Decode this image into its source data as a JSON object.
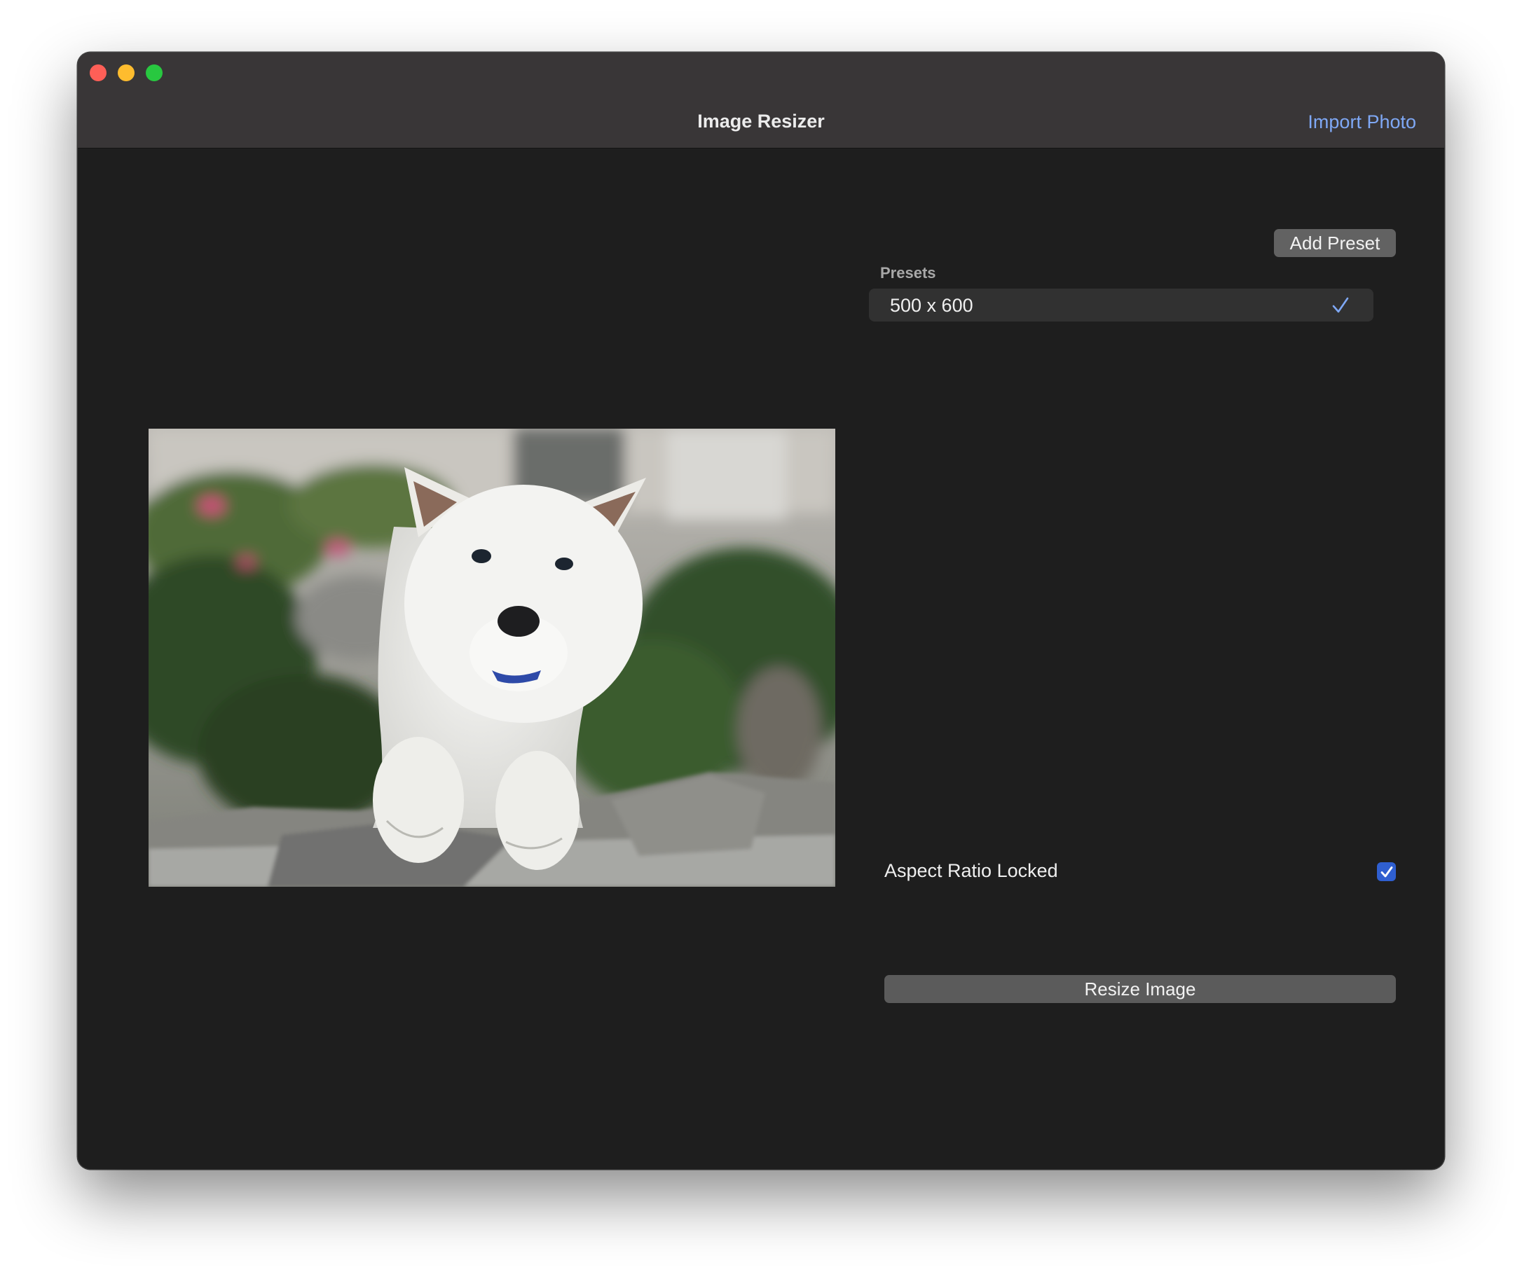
{
  "window": {
    "title": "Image Resizer",
    "import_label": "Import Photo"
  },
  "colors": {
    "accent_link": "#7fa8f5",
    "checkbox": "#2f5fd0",
    "window_bg": "#1e1e1e",
    "titlebar_bg": "#393637"
  },
  "photo": {
    "subject": "white puppy leaning over a stone wall with garden plants behind"
  },
  "presets": {
    "add_label": "Add Preset",
    "header": "Presets",
    "items": [
      {
        "label": "500 x 600",
        "selected": true
      }
    ]
  },
  "options": {
    "aspect_label": "Aspect Ratio Locked",
    "aspect_locked": true
  },
  "actions": {
    "resize_label": "Resize Image"
  },
  "icons": {
    "selected": "checkmark-icon",
    "checkbox": "checkmark-icon"
  }
}
